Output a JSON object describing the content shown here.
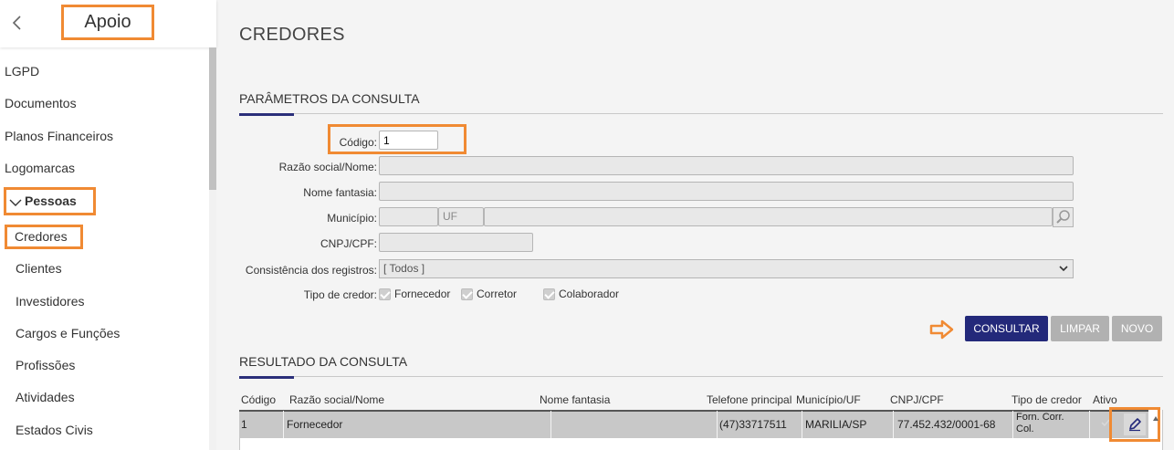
{
  "sidebar": {
    "title": "Apoio",
    "items": [
      {
        "label": "LGPD"
      },
      {
        "label": "Documentos"
      },
      {
        "label": "Planos Financeiros"
      },
      {
        "label": "Logomarcas"
      }
    ],
    "group": {
      "label": "Pessoas",
      "expanded": true
    },
    "sub_items": [
      {
        "label": "Credores",
        "active": true
      },
      {
        "label": "Clientes"
      },
      {
        "label": "Investidores"
      },
      {
        "label": "Cargos e Funções"
      },
      {
        "label": "Profissões"
      },
      {
        "label": "Atividades"
      },
      {
        "label": "Estados Civis"
      }
    ]
  },
  "page": {
    "title": "CREDORES"
  },
  "params": {
    "section_title": "PARÂMETROS DA CONSULTA",
    "codigo_label": "Código:",
    "codigo_value": "1",
    "razao_label": "Razão social/Nome:",
    "fantasia_label": "Nome fantasia:",
    "municipio_label": "Município:",
    "uf_placeholder": "UF",
    "cnpj_label": "CNPJ/CPF:",
    "consistencia_label": "Consistência dos registros:",
    "consistencia_value": "[ Todos ]",
    "tipo_label": "Tipo de credor:",
    "tipos": [
      {
        "label": "Fornecedor",
        "checked": true
      },
      {
        "label": "Corretor",
        "checked": true
      },
      {
        "label": "Colaborador",
        "checked": true
      }
    ]
  },
  "actions": {
    "consultar": "CONSULTAR",
    "limpar": "LIMPAR",
    "novo": "NOVO"
  },
  "results": {
    "section_title": "RESULTADO DA CONSULTA",
    "columns": [
      "Código",
      "Razão social/Nome",
      "Nome fantasia",
      "Telefone principal",
      "Município/UF",
      "CNPJ/CPF",
      "Tipo de credor",
      "Ativo"
    ],
    "rows": [
      {
        "codigo": "1",
        "razao": "Fornecedor",
        "fantasia": "",
        "telefone": "(47)33717511",
        "municipio": "MARILIA/SP",
        "cnpj": "77.452.432/0001-68",
        "tipo_line1": "Forn. Corr.",
        "tipo_line2": "Col."
      }
    ]
  },
  "colors": {
    "accent": "#23297a",
    "highlight": "#f08a33",
    "button_gray": "#b1b1b1"
  },
  "icons": {
    "back": "chevron-left-icon",
    "group": "chevron-down-icon",
    "search": "magnifier-icon",
    "edit": "pencil-icon",
    "annotation": "arrow-right-icon"
  }
}
